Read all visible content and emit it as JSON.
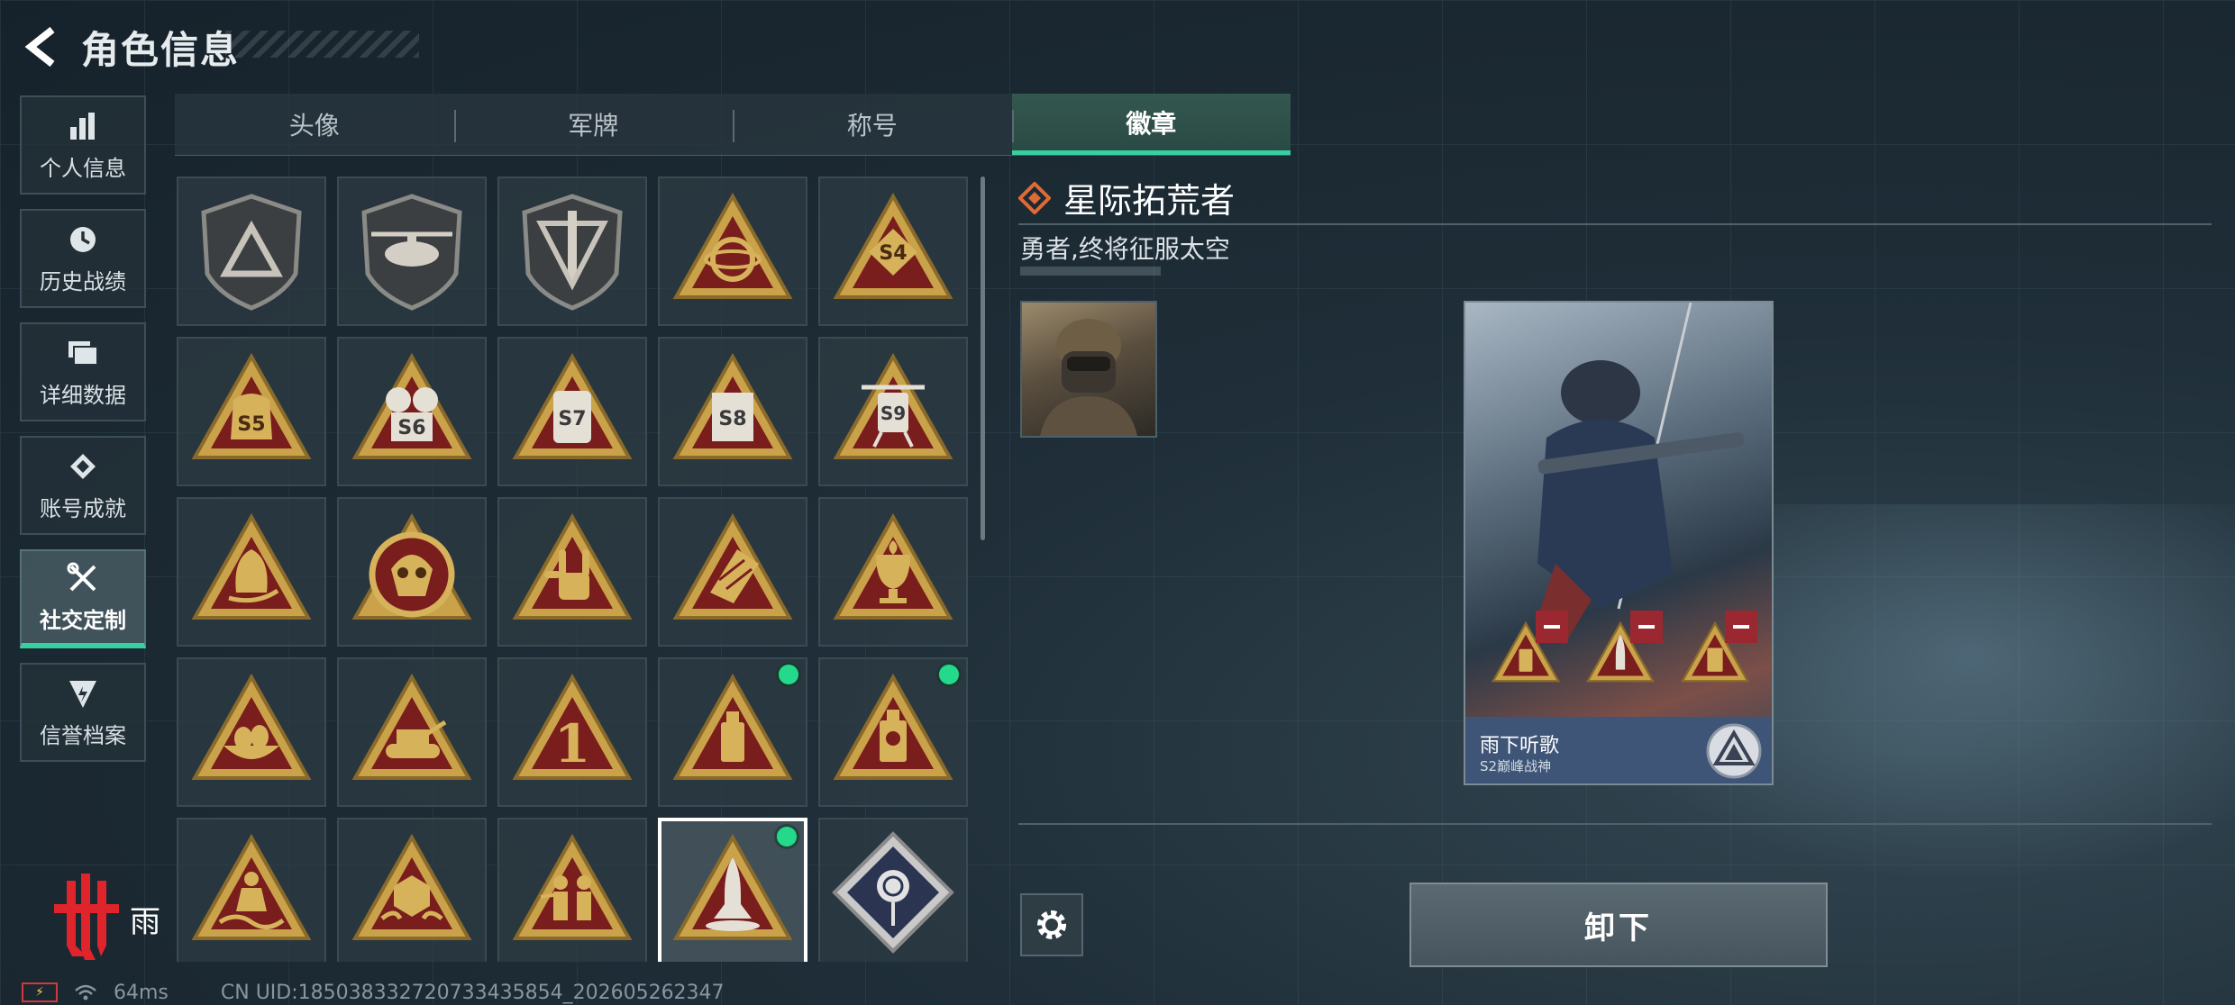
{
  "header": {
    "title": "角色信息"
  },
  "nav": [
    {
      "label": "个人信息",
      "icon": "bar-chart-icon",
      "active": false
    },
    {
      "label": "历史战绩",
      "icon": "history-icon",
      "active": false
    },
    {
      "label": "详细数据",
      "icon": "folder-icon",
      "active": false
    },
    {
      "label": "账号成就",
      "icon": "achievement-icon",
      "active": false
    },
    {
      "label": "社交定制",
      "icon": "tools-icon",
      "active": true
    },
    {
      "label": "信誉档案",
      "icon": "credit-shield-icon",
      "active": false
    }
  ],
  "tabs": [
    {
      "label": "头像",
      "active": false
    },
    {
      "label": "军牌",
      "active": false
    },
    {
      "label": "称号",
      "active": false
    },
    {
      "label": "徽章",
      "active": true
    }
  ],
  "badges": {
    "row1_labels": [
      "S4"
    ],
    "season_labels": [
      "S5",
      "S6",
      "S7",
      "S8",
      "S9"
    ],
    "number_badge": "1",
    "new_dots": "3"
  },
  "detail": {
    "name": "星际拓荒者",
    "description": "勇者,终将征服太空"
  },
  "card": {
    "player_name": "雨下听歌",
    "rank": "S2巅峰战神"
  },
  "actions": {
    "unequip_label": "卸下"
  },
  "overlay": {
    "logo_text": "雨"
  },
  "status": {
    "ping": "64ms",
    "uid": "CN UID:18503833272073343585​4_202605262347"
  },
  "colors": {
    "accent": "#37d0a0",
    "badge_gold": "#c9a24a",
    "badge_red": "#7a1d1d",
    "new_dot": "#25d98c",
    "minus_red": "#9b2731",
    "title_diamond": "#e06a35"
  }
}
